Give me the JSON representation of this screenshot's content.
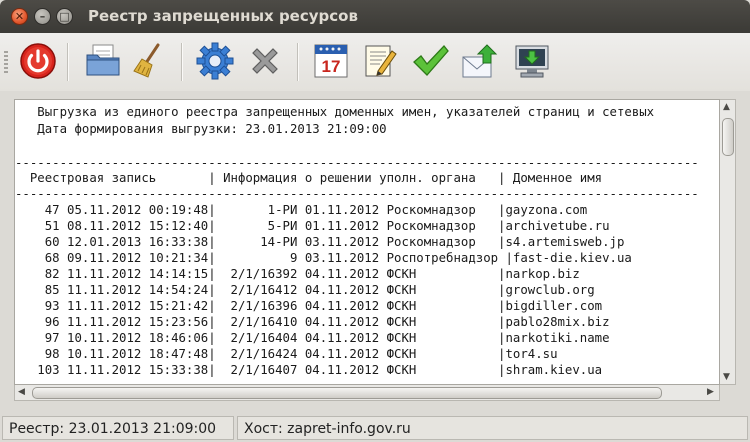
{
  "window": {
    "title": "Реестр запрещенных ресурсов"
  },
  "toolbar": {
    "buttons": [
      {
        "name": "power-button",
        "icon": "power-icon"
      },
      {
        "name": "open-button",
        "icon": "folder-icon"
      },
      {
        "name": "clear-button",
        "icon": "broom-icon"
      },
      {
        "name": "settings-button",
        "icon": "gear-icon"
      },
      {
        "name": "delete-button",
        "icon": "close-x-icon"
      },
      {
        "name": "calendar-button",
        "icon": "calendar-icon",
        "text": "17"
      },
      {
        "name": "edit-button",
        "icon": "edit-document-icon"
      },
      {
        "name": "confirm-button",
        "icon": "checkmark-icon"
      },
      {
        "name": "send-mail-button",
        "icon": "mail-up-icon"
      },
      {
        "name": "download-button",
        "icon": "monitor-download-icon"
      }
    ]
  },
  "document": {
    "header_lines": [
      "   Выгрузка из единого реестра запрещенных доменных имен, указателей страниц и сетевых",
      "   Дата формирования выгрузки: 23.01.2013 21:09:00"
    ],
    "separator": "--------------------------------------------------------------------------------------------",
    "column_header": "  Реестровая запись       | Информация о решении уполн. органа   | Доменное имя",
    "rows": [
      "    47 05.11.2012 00:19:48|       1-РИ 01.11.2012 Роскомнадзор   |gayzona.com",
      "    51 08.11.2012 15:12:40|       5-РИ 01.11.2012 Роскомнадзор   |archivetube.ru",
      "    60 12.01.2013 16:33:38|      14-РИ 03.11.2012 Роскомнадзор   |s4.artemisweb.jp",
      "    68 09.11.2012 10:21:34|          9 03.11.2012 Роспотребнадзор |fast-die.kiev.ua",
      "    82 11.11.2012 14:14:15|  2/1/16392 04.11.2012 ФСКН           |narkop.biz",
      "    85 11.11.2012 14:54:24|  2/1/16412 04.11.2012 ФСКН           |growclub.org",
      "    93 11.11.2012 15:21:42|  2/1/16396 04.11.2012 ФСКН           |bigdiller.com",
      "    96 11.11.2012 15:23:56|  2/1/16410 04.11.2012 ФСКН           |pablo28mix.biz",
      "    97 10.11.2012 18:46:06|  2/1/16404 04.11.2012 ФСКН           |narkotiki.name",
      "    98 10.11.2012 18:47:48|  2/1/16424 04.11.2012 ФСКН           |tor4.su",
      "   103 11.11.2012 15:33:38|  2/1/16407 04.11.2012 ФСКН           |shram.kiev.ua"
    ]
  },
  "status": {
    "registry": "Реестр: 23.01.2013 21:09:00",
    "host": "Хост: zapret-info.gov.ru"
  }
}
